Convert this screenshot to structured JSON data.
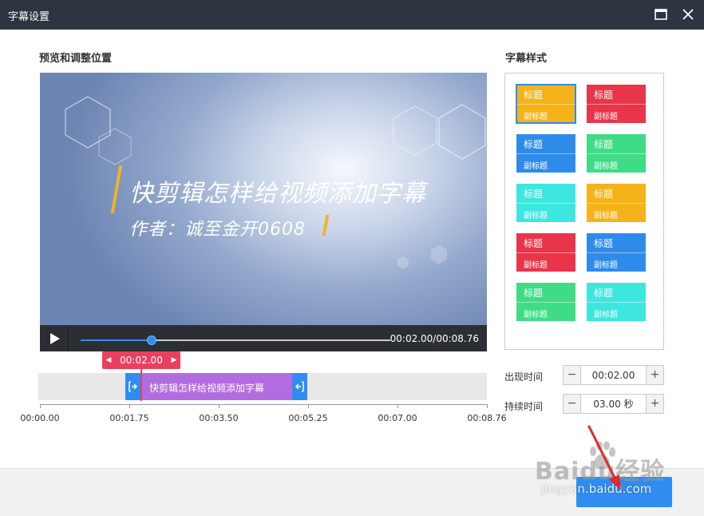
{
  "window": {
    "title": "字幕设置"
  },
  "preview_section": {
    "label": "预览和调整位置"
  },
  "preview": {
    "main_subtitle": "快剪辑怎样给视频添加字幕",
    "sub_subtitle": "作者：诚至金开0608"
  },
  "player": {
    "time_display": "00:02.00/00:08.76",
    "progress_fraction": 0.23
  },
  "timeline": {
    "playhead_time": "00:02.00",
    "clip_text": "快剪辑怎样给视频添加字幕",
    "ticks": [
      "00:00.00",
      "00:01.75",
      "00:03.50",
      "00:05.25",
      "00:07.00",
      "00:08.76"
    ]
  },
  "style_section": {
    "label": "字幕样式",
    "tiles": [
      {
        "title": "标题",
        "subtitle": "副标题",
        "color": "#f5b21a",
        "selected": true
      },
      {
        "title": "标题",
        "subtitle": "副标题",
        "color": "#e8354a",
        "selected": false
      },
      {
        "title": "标题",
        "subtitle": "副标题",
        "color": "#2f8bea",
        "selected": false
      },
      {
        "title": "标题",
        "subtitle": "副标题",
        "color": "#3fdc86",
        "selected": false
      },
      {
        "title": "标题",
        "subtitle": "副标题",
        "color": "#3ee6e0",
        "selected": false
      },
      {
        "title": "标题",
        "subtitle": "副标题",
        "color": "#f5b21a",
        "selected": false
      },
      {
        "title": "标题",
        "subtitle": "副标题",
        "color": "#e8354a",
        "selected": false
      },
      {
        "title": "标题",
        "subtitle": "副标题",
        "color": "#2f8bea",
        "selected": false
      },
      {
        "title": "标题",
        "subtitle": "副标题",
        "color": "#3fdc86",
        "selected": false
      },
      {
        "title": "标题",
        "subtitle": "副标题",
        "color": "#3ee6e0",
        "selected": false
      }
    ]
  },
  "fields": {
    "appear_time": {
      "label": "出现时间",
      "value": "00:02.00"
    },
    "duration": {
      "label": "持续时间",
      "value": "03.00 秒"
    }
  },
  "footer": {
    "ok_label": ""
  },
  "watermark": {
    "line1": "Baidu经验",
    "line2": "jingyan.baidu.com"
  },
  "colors": {
    "titlebar": "#2d3541",
    "accent": "#2f8df2",
    "playhead": "#e9405f",
    "clip": "#b26ce0"
  }
}
